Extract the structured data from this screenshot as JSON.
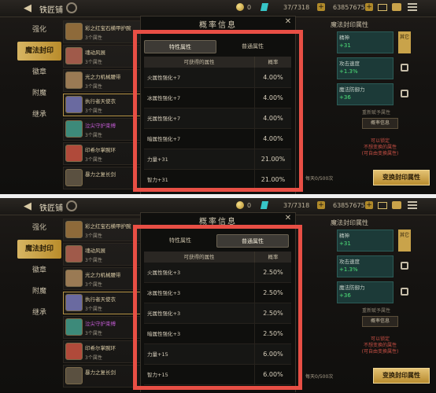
{
  "screens": [
    {
      "app_title": "铁匠铺",
      "currency": {
        "small": "0",
        "gem": "37/7318",
        "gold": "63857675"
      },
      "nav": [
        "强化",
        "魔法封印",
        "徽章",
        "附魔",
        "继承"
      ],
      "nav_active": 1,
      "list": [
        {
          "name": "彩之红宝石横甲护腕",
          "count": "3个属性",
          "color": "#d8c9a4",
          "icon": "#8e6a3a"
        },
        {
          "name": "魂动风展",
          "count": "3个属性",
          "color": "#d8c9a4",
          "icon": "#a05a4a"
        },
        {
          "name": "光之力机械腰带",
          "count": "3个属性",
          "color": "#d8c9a4",
          "icon": "#9a7a54"
        },
        {
          "name": "执行者天使衣",
          "count": "3个属性",
          "color": "#d8c9a4",
          "icon": "#6a6aa0"
        },
        {
          "name": "泣尖守护束缚",
          "count": "3个属性",
          "color": "#c05ad0",
          "icon": "#3d8a7a"
        },
        {
          "name": "印希尔掌腕环",
          "count": "3个属性",
          "color": "#d8c9a4",
          "icon": "#b04a3a"
        },
        {
          "name": "暴力之复长剑",
          "count": "",
          "color": "#d8c9a4",
          "icon": "#5a5040"
        }
      ],
      "right": {
        "title": "魔法封印属性",
        "slots": [
          {
            "name": "精神",
            "value": "+31",
            "button": "其它"
          },
          {
            "name": "攻击速度",
            "value": "+1.3%",
            "button": ""
          },
          {
            "name": "魔法防御力",
            "value": "+36",
            "button": ""
          }
        ],
        "hint": "重新赋予属性",
        "prob_button": "概率信息",
        "red_hint_1": "可以锁定",
        "red_hint_2": "不想变换的属性",
        "red_hint_3": "(可自由变换属性)",
        "remain": "每天0/500次",
        "refine_button": "变换封印属性"
      },
      "modal": {
        "title": "概率信息",
        "tabs": [
          "特性属性",
          "普通属性"
        ],
        "active_tab": 0,
        "header": [
          "可获得的属性",
          "概率"
        ],
        "rows": [
          {
            "attr": "火属性强化+7",
            "prob": "4.00%"
          },
          {
            "attr": "冰属性强化+7",
            "prob": "4.00%"
          },
          {
            "attr": "光属性强化+7",
            "prob": "4.00%"
          },
          {
            "attr": "暗属性强化+7",
            "prob": "4.00%"
          },
          {
            "attr": "力量+31",
            "prob": "21.00%"
          },
          {
            "attr": "智力+31",
            "prob": "21.00%"
          }
        ]
      }
    },
    {
      "app_title": "铁匠铺",
      "currency": {
        "small": "0",
        "gem": "37/7318",
        "gold": "63857675"
      },
      "nav": [
        "强化",
        "魔法封印",
        "徽章",
        "附魔",
        "继承"
      ],
      "nav_active": 1,
      "list": [
        {
          "name": "彩之红宝石横甲护腕",
          "count": "3个属性",
          "color": "#d8c9a4",
          "icon": "#8e6a3a"
        },
        {
          "name": "魂动风展",
          "count": "3个属性",
          "color": "#d8c9a4",
          "icon": "#a05a4a"
        },
        {
          "name": "光之力机械腰带",
          "count": "3个属性",
          "color": "#d8c9a4",
          "icon": "#9a7a54"
        },
        {
          "name": "执行者天使衣",
          "count": "3个属性",
          "color": "#d8c9a4",
          "icon": "#6a6aa0"
        },
        {
          "name": "泣尖守护束缚",
          "count": "3个属性",
          "color": "#c05ad0",
          "icon": "#3d8a7a"
        },
        {
          "name": "印希尔掌腕环",
          "count": "3个属性",
          "color": "#d8c9a4",
          "icon": "#b04a3a"
        },
        {
          "name": "暴力之复长剑",
          "count": "",
          "color": "#d8c9a4",
          "icon": "#5a5040"
        }
      ],
      "right": {
        "title": "魔法封印属性",
        "slots": [
          {
            "name": "精神",
            "value": "+31",
            "button": "其它"
          },
          {
            "name": "攻击速度",
            "value": "+1.3%",
            "button": ""
          },
          {
            "name": "魔法防御力",
            "value": "+36",
            "button": ""
          }
        ],
        "hint": "重新赋予属性",
        "prob_button": "概率信息",
        "red_hint_1": "可以锁定",
        "red_hint_2": "不想变换的属性",
        "red_hint_3": "(可自由变换属性)",
        "remain": "每天0/500次",
        "refine_button": "变换封印属性"
      },
      "modal": {
        "title": "概率信息",
        "tabs": [
          "特性属性",
          "普通属性"
        ],
        "active_tab": 1,
        "header": [
          "可获得的属性",
          "概率"
        ],
        "rows": [
          {
            "attr": "火属性强化+3",
            "prob": "2.50%"
          },
          {
            "attr": "冰属性强化+3",
            "prob": "2.50%"
          },
          {
            "attr": "光属性强化+3",
            "prob": "2.50%"
          },
          {
            "attr": "暗属性强化+3",
            "prob": "2.50%"
          },
          {
            "attr": "力量+15",
            "prob": "6.00%"
          },
          {
            "attr": "智力+15",
            "prob": "6.00%"
          }
        ]
      }
    }
  ]
}
